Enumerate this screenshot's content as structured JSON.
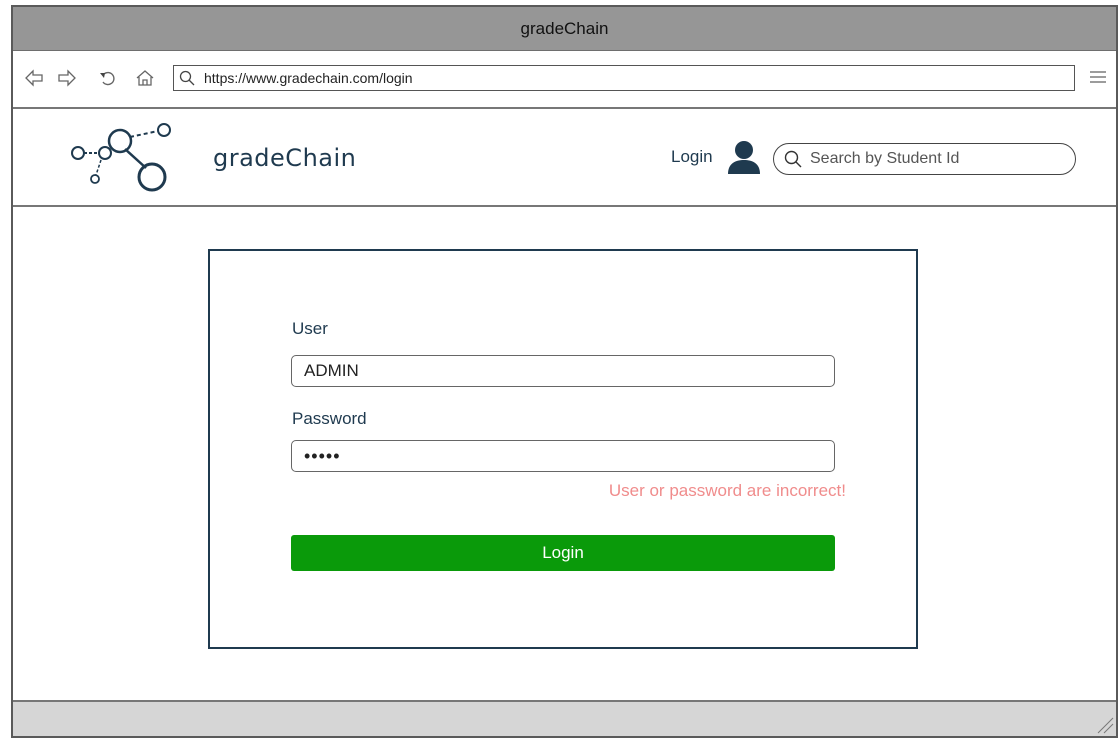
{
  "window": {
    "title": "gradeChain"
  },
  "browser": {
    "url": "https://www.gradechain.com/login",
    "nav_icons": [
      "back-arrow-icon",
      "forward-arrow-icon",
      "refresh-icon",
      "home-icon"
    ]
  },
  "header": {
    "logo_text": "gradeChain",
    "login_label": "Login",
    "search_placeholder": "Search by Student Id"
  },
  "form": {
    "user_label": "User",
    "user_value": "ADMIN",
    "password_label": "Password",
    "password_value": "•••••",
    "error_message": "User or password are incorrect!",
    "submit_label": "Login"
  },
  "colors": {
    "brand": "#1f3a4f",
    "error": "#f08c8c",
    "button": "#0a9a0a"
  }
}
